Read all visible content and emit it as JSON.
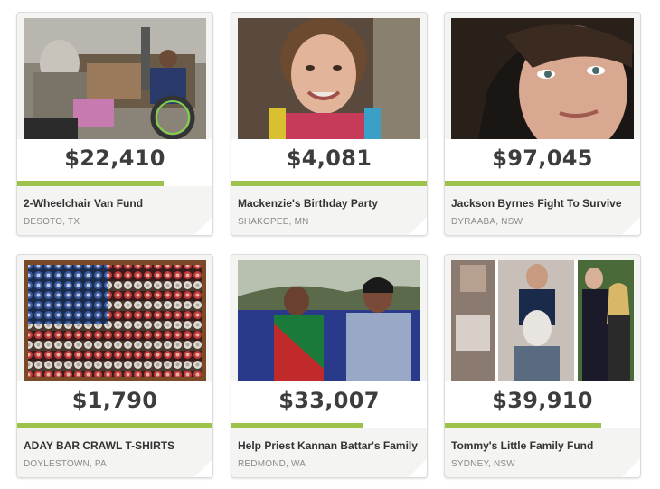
{
  "campaigns": [
    {
      "amount": "$22,410",
      "title": "2-Wheelchair Van Fund",
      "location": "DESOTO, TX",
      "progress": 0.75,
      "image": "wheelchair-van-photo"
    },
    {
      "amount": "$4,081",
      "title": "Mackenzie's Birthday Party",
      "location": "SHAKOPEE, MN",
      "progress": 1.0,
      "image": "girl-portrait-photo"
    },
    {
      "amount": "$97,045",
      "title": "Jackson Byrnes Fight To Survive",
      "location": "DYRAABA, NSW",
      "progress": 1.0,
      "image": "young-man-portrait-photo"
    },
    {
      "amount": "$1,790",
      "title": "ADAY BAR CRAWL T-SHIRTS",
      "location": "DOYLESTOWN, PA",
      "progress": 1.0,
      "image": "bottle-cap-flag-photo"
    },
    {
      "amount": "$33,007",
      "title": "Help Priest Kannan Battar's Family",
      "location": "REDMOND, WA",
      "progress": 0.67,
      "image": "couple-on-sofa-photo"
    },
    {
      "amount": "$39,910",
      "title": "Tommy's Little Family Fund",
      "location": "SYDNEY, NSW",
      "progress": 0.8,
      "image": "family-collage-photo"
    }
  ],
  "colors": {
    "progress_fill": "#9cc24b",
    "card_background": "#f4f4f2",
    "amount_text": "#3d3d3d"
  }
}
